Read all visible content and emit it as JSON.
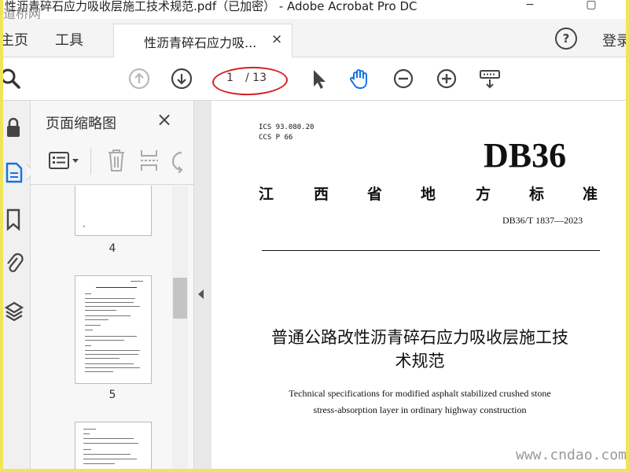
{
  "window": {
    "title": "性沥青碎石应力吸收层施工技术规范.pdf（已加密） - Adobe Acrobat Pro DC",
    "minimize": "−",
    "restore": "▢"
  },
  "tabs": {
    "home": "主页",
    "tools": "工具",
    "document": "性沥青碎石应力吸...",
    "close": "×",
    "help": "?",
    "login": "登录"
  },
  "toolbar": {
    "current_page": "1",
    "total_pages": "/ 13",
    "highlight_color": "#d62020",
    "accent_color": "#1473e6"
  },
  "thumbnails": {
    "title": "页面缩略图",
    "close": "×",
    "pages": [
      {
        "number": "4"
      },
      {
        "number": "5"
      }
    ]
  },
  "document": {
    "ics": "ICS 93.080.20",
    "ccs": "CCS P 66",
    "standard_code": "DB36",
    "province_chars": [
      "江",
      "西",
      "省",
      "地",
      "方",
      "标",
      "准"
    ],
    "standard_number": "DB36/T 1837—2023",
    "title_zh_line1": "普通公路改性沥青碎石应力吸收层施工技",
    "title_zh_line2": "术规范",
    "title_en_line1": "Technical specifications for modified asphalt stabilized crushed stone",
    "title_en_line2": "stress-absorption layer in ordinary highway construction"
  },
  "watermark": {
    "logo_text": "道桥网",
    "site": "www.cndao.com"
  },
  "icons": {
    "search": "search-icon",
    "prev": "arrow-up-circle-icon",
    "next": "arrow-down-circle-icon",
    "select": "cursor-icon",
    "hand": "hand-icon",
    "zoom_out": "zoom-out-icon",
    "zoom_in": "zoom-in-icon",
    "keyboard": "keyboard-icon"
  }
}
